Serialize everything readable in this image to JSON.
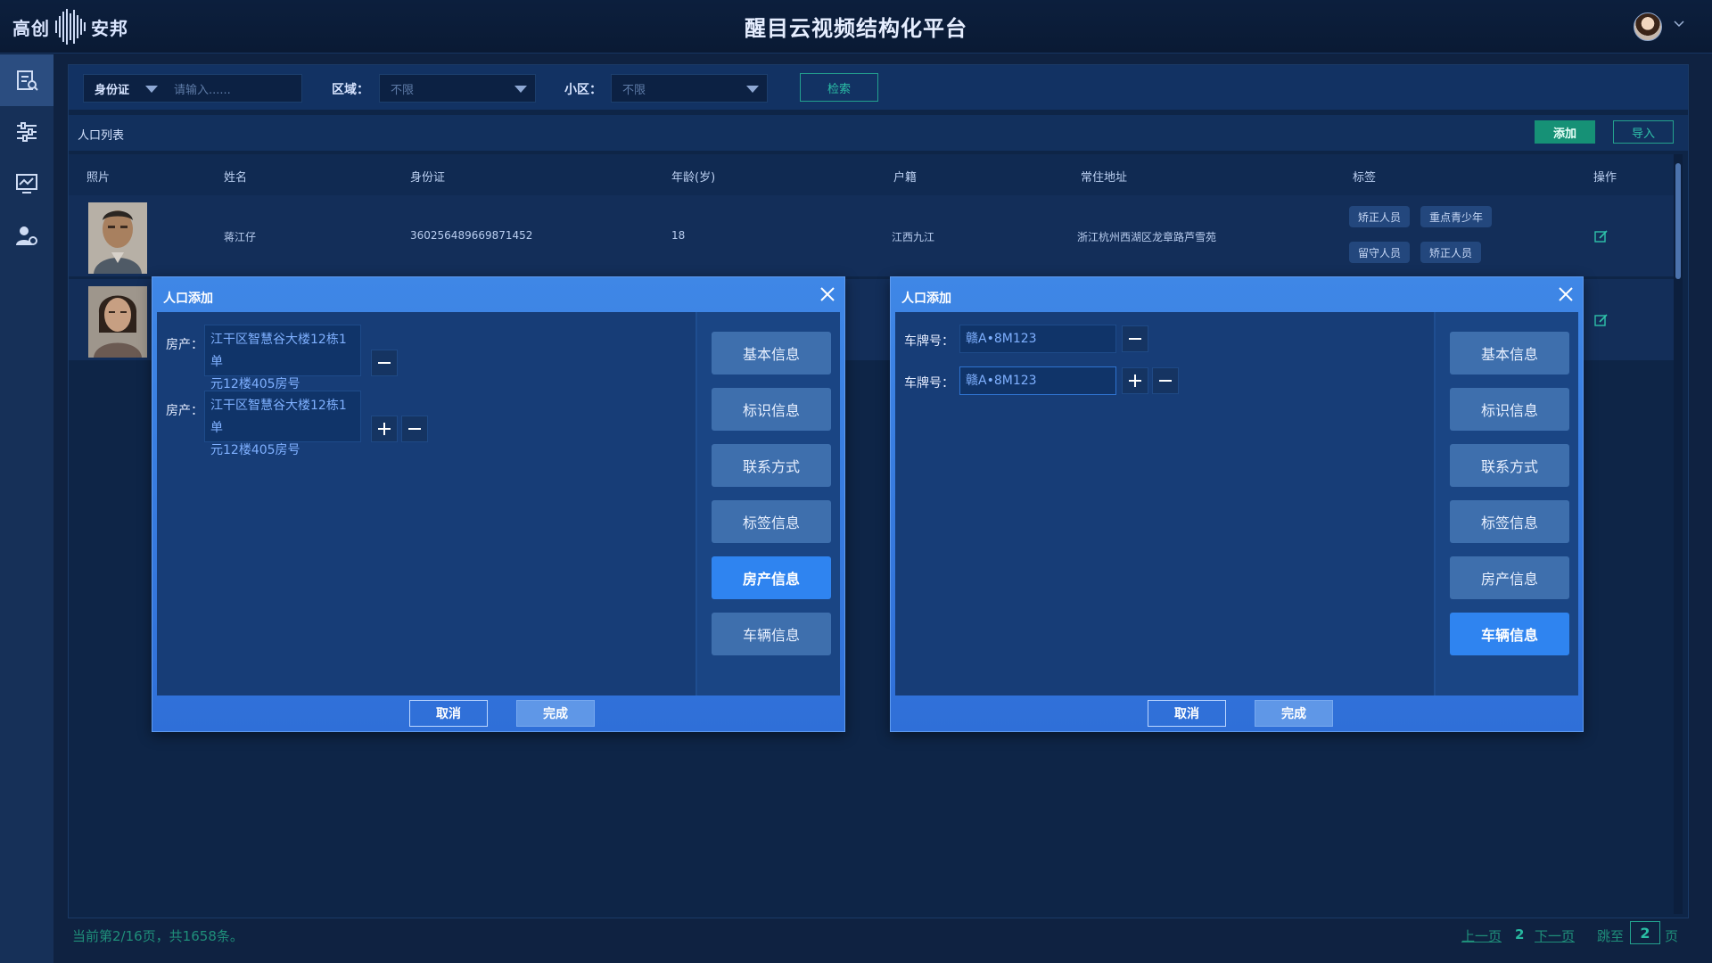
{
  "brand": {
    "name_left": "高创",
    "name_right": "安邦",
    "title": "醒目云视频结构化平台"
  },
  "sidebar": {
    "items": [
      {
        "icon": "report-icon"
      },
      {
        "icon": "sliders-icon"
      },
      {
        "icon": "monitor-icon"
      },
      {
        "icon": "user-settings-icon"
      }
    ]
  },
  "filters": {
    "id_type": "身份证",
    "id_placeholder": "请输入......",
    "area_label": "区域：",
    "area_value": "不限",
    "community_label": "小区：",
    "community_value": "不限",
    "search_label": "检索"
  },
  "list": {
    "title": "人口列表",
    "add_label": "添加",
    "import_label": "导入",
    "columns": [
      "照片",
      "姓名",
      "身份证",
      "年龄(岁)",
      "户籍",
      "常住地址",
      "标签",
      "操作"
    ],
    "rows": [
      {
        "name": "蒋江仔",
        "id": "360256489669871452",
        "age": "18",
        "hukou": "江西九江",
        "address": "浙江杭州西湖区龙章路芦雪苑",
        "tags": [
          "矫正人员",
          "重点青少年",
          "留守人员",
          "矫正人员"
        ]
      },
      {
        "name": "",
        "id": "",
        "age": "",
        "hukou": "",
        "address": "",
        "tags": []
      }
    ]
  },
  "footer": {
    "summary": "当前第2/16页，共1658条。",
    "prev": "上一页",
    "current": "2",
    "next": "下一页",
    "jump_prefix": "跳至",
    "jump_value": "2",
    "jump_suffix": "页"
  },
  "modal_left": {
    "title": "人口添加",
    "field_label": "房产：",
    "properties": [
      {
        "line1": "江干区智慧谷大楼12栋1单",
        "line2": "元12楼405房号"
      },
      {
        "line1": "江干区智慧谷大楼12栋1单",
        "line2": "元12楼405房号"
      }
    ],
    "nav": [
      "基本信息",
      "标识信息",
      "联系方式",
      "标签信息",
      "房产信息",
      "车辆信息"
    ],
    "active_nav": "房产信息",
    "cancel_label": "取消",
    "done_label": "完成"
  },
  "modal_right": {
    "title": "人口添加",
    "field_label": "车牌号：",
    "plates": [
      "赣A•8M123",
      "赣A•8M123"
    ],
    "nav": [
      "基本信息",
      "标识信息",
      "联系方式",
      "标签信息",
      "房产信息",
      "车辆信息"
    ],
    "active_nav": "车辆信息",
    "cancel_label": "取消",
    "done_label": "完成"
  },
  "colors": {
    "accent": "#2f84f0",
    "teal": "#169176",
    "bg": "#0f2241"
  }
}
